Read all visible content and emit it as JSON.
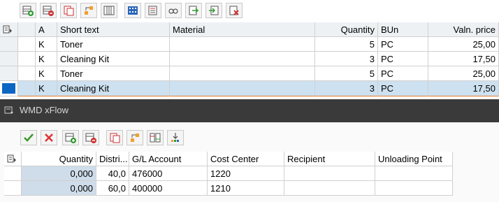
{
  "top_toolbar": {
    "buttons": [
      "append-row-icon",
      "delete-row-icon",
      "copy-row-icon",
      "sort-icon",
      "columns-icon",
      "calculator-icon",
      "details-icon",
      "find-icon",
      "export-icon",
      "import-icon",
      "clear-icon"
    ]
  },
  "items_table": {
    "columns": [
      "A",
      "Short text",
      "Material",
      "Quantity",
      "BUn",
      "Valn. price"
    ],
    "rows": [
      {
        "a": "K",
        "short_text": "Toner",
        "material": "",
        "quantity": "5",
        "bun": "PC",
        "price": "25,00"
      },
      {
        "a": "K",
        "short_text": "Cleaning Kit",
        "material": "",
        "quantity": "3",
        "bun": "PC",
        "price": "17,50"
      },
      {
        "a": "K",
        "short_text": "Toner",
        "material": "",
        "quantity": "5",
        "bun": "PC",
        "price": "25,00"
      },
      {
        "a": "K",
        "short_text": "Cleaning Kit",
        "material": "",
        "quantity": "3",
        "bun": "PC",
        "price": "17,50"
      }
    ],
    "selected_row": 3
  },
  "section": {
    "title": "WMD xFlow"
  },
  "lower_toolbar": {
    "buttons": [
      "accept-icon",
      "cancel-icon",
      "append-row-icon",
      "delete-row-icon",
      "copy-row-icon",
      "sort-icon",
      "columns-icon",
      "download-icon"
    ]
  },
  "account_table": {
    "columns": [
      "Quantity",
      "Distri...",
      "G/L Account",
      "Cost Center",
      "Recipient",
      "Unloading Point"
    ],
    "rows": [
      {
        "quantity": "0,000",
        "distri": "40,0",
        "gl": "476000",
        "cost_center": "1220",
        "recipient": "",
        "unloading": ""
      },
      {
        "quantity": "0,000",
        "distri": "60,0",
        "gl": "400000",
        "cost_center": "1210",
        "recipient": "",
        "unloading": ""
      }
    ]
  },
  "colors": {
    "selection": "#cde1f0",
    "header": "#eef1f4",
    "dark_bar": "#3a3a3a",
    "selector_blue": "#0a66c2"
  }
}
